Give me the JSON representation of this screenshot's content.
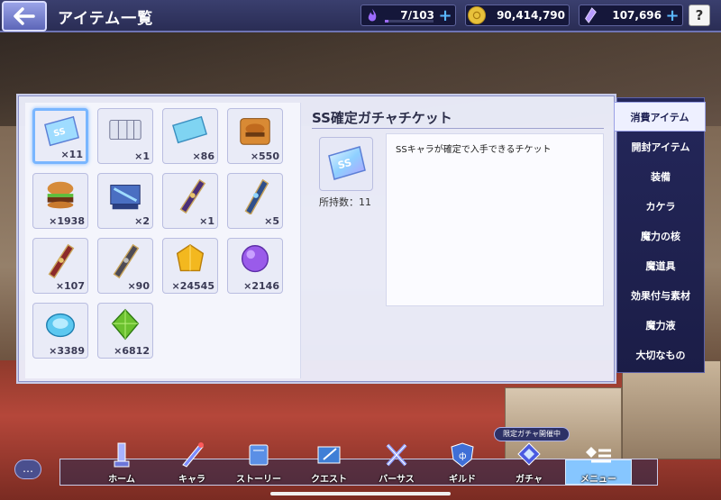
{
  "header": {
    "title": "アイテム一覧",
    "stamina": {
      "value": "7/103",
      "fill_fraction": 0.07,
      "color": "#9d6bff"
    },
    "gold": {
      "value": "90,414,790",
      "color": "#e8c13b"
    },
    "gems": {
      "value": "107,696",
      "color": "#b89cff"
    },
    "help_label": "?"
  },
  "items": [
    {
      "name": "ss-ticket",
      "count": "×11",
      "selected": true
    },
    {
      "name": "ticket-bundle",
      "count": "×1"
    },
    {
      "name": "blue-ticket",
      "count": "×86"
    },
    {
      "name": "burger-crate",
      "count": "×550"
    },
    {
      "name": "burger",
      "count": "×1938"
    },
    {
      "name": "blue-machine",
      "count": "×2"
    },
    {
      "name": "purple-scroll",
      "count": "×1"
    },
    {
      "name": "blue-tube",
      "count": "×5"
    },
    {
      "name": "red-tube",
      "count": "×107"
    },
    {
      "name": "dark-tube",
      "count": "×90"
    },
    {
      "name": "yellow-crystal",
      "count": "×24545"
    },
    {
      "name": "purple-crystal",
      "count": "×2146"
    },
    {
      "name": "blue-gem",
      "count": "×3389"
    },
    {
      "name": "green-gem",
      "count": "×6812"
    }
  ],
  "detail": {
    "title": "SS確定ガチャチケット",
    "owned_label": "所持数：11",
    "description": "SSキャラが確定で入手できるチケット"
  },
  "side_menu": [
    {
      "label": "消費アイテム",
      "active": true
    },
    {
      "label": "開封アイテム"
    },
    {
      "label": "装備"
    },
    {
      "label": "カケラ"
    },
    {
      "label": "魔力の核"
    },
    {
      "label": "魔道具"
    },
    {
      "label": "効果付与素材"
    },
    {
      "label": "魔力液"
    },
    {
      "label": "大切なもの"
    }
  ],
  "nav": [
    {
      "label": "ホーム",
      "icon": "tower-icon"
    },
    {
      "label": "キャラ",
      "icon": "sword-icon"
    },
    {
      "label": "ストーリー",
      "icon": "book-icon"
    },
    {
      "label": "クエスト",
      "icon": "quest-icon"
    },
    {
      "label": "バーサス",
      "icon": "crossed-swords-icon"
    },
    {
      "label": "ギルド",
      "icon": "shield-icon"
    },
    {
      "label": "ガチャ",
      "icon": "gacha-icon"
    },
    {
      "label": "メニュー",
      "icon": "menu-icon",
      "active": true
    }
  ],
  "gacha_badge": "限定ガチャ開催中",
  "chat_label": "…"
}
